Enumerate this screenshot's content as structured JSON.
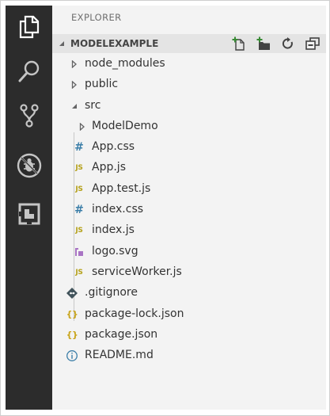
{
  "activity_bar": {
    "items": [
      {
        "icon": "files-icon"
      },
      {
        "icon": "search-icon"
      },
      {
        "icon": "source-control-icon"
      },
      {
        "icon": "debug-icon"
      },
      {
        "icon": "extensions-icon"
      }
    ],
    "background": "#2c2c2c",
    "icon_color": "#c5c5c5",
    "active_icon_color": "#ffffff"
  },
  "sidebar": {
    "title": "EXPLORER",
    "background": "#f3f3f3"
  },
  "section": {
    "title": "MODELEXAMPLE",
    "actions": [
      {
        "icon": "new-file-icon"
      },
      {
        "icon": "new-folder-icon"
      },
      {
        "icon": "refresh-icon"
      },
      {
        "icon": "collapse-all-icon"
      }
    ]
  },
  "tree": {
    "items": [
      {
        "label": "node_modules",
        "kind": "folder",
        "expanded": false,
        "depth": 0
      },
      {
        "label": "public",
        "kind": "folder",
        "expanded": false,
        "depth": 0
      },
      {
        "label": "src",
        "kind": "folder",
        "expanded": true,
        "depth": 0
      },
      {
        "label": "ModelDemo",
        "kind": "folder",
        "expanded": false,
        "depth": 1
      },
      {
        "label": "App.css",
        "kind": "css",
        "depth": 1
      },
      {
        "label": "App.js",
        "kind": "js",
        "depth": 1
      },
      {
        "label": "App.test.js",
        "kind": "js",
        "depth": 1
      },
      {
        "label": "index.css",
        "kind": "css",
        "depth": 1
      },
      {
        "label": "index.js",
        "kind": "js",
        "depth": 1
      },
      {
        "label": "logo.svg",
        "kind": "svg",
        "depth": 1
      },
      {
        "label": "serviceWorker.js",
        "kind": "js",
        "depth": 1
      },
      {
        "label": ".gitignore",
        "kind": "git",
        "depth": 0
      },
      {
        "label": "package-lock.json",
        "kind": "json",
        "depth": 0
      },
      {
        "label": "package.json",
        "kind": "json",
        "depth": 0
      },
      {
        "label": "README.md",
        "kind": "info",
        "depth": 0
      }
    ]
  },
  "colors": {
    "js": "#b5a11a",
    "css": "#3b7ea8",
    "json": "#c8a41a",
    "svg": "#a974c4",
    "git": "#41535b",
    "info": "#3b7ea8",
    "twistie": "#646465"
  }
}
